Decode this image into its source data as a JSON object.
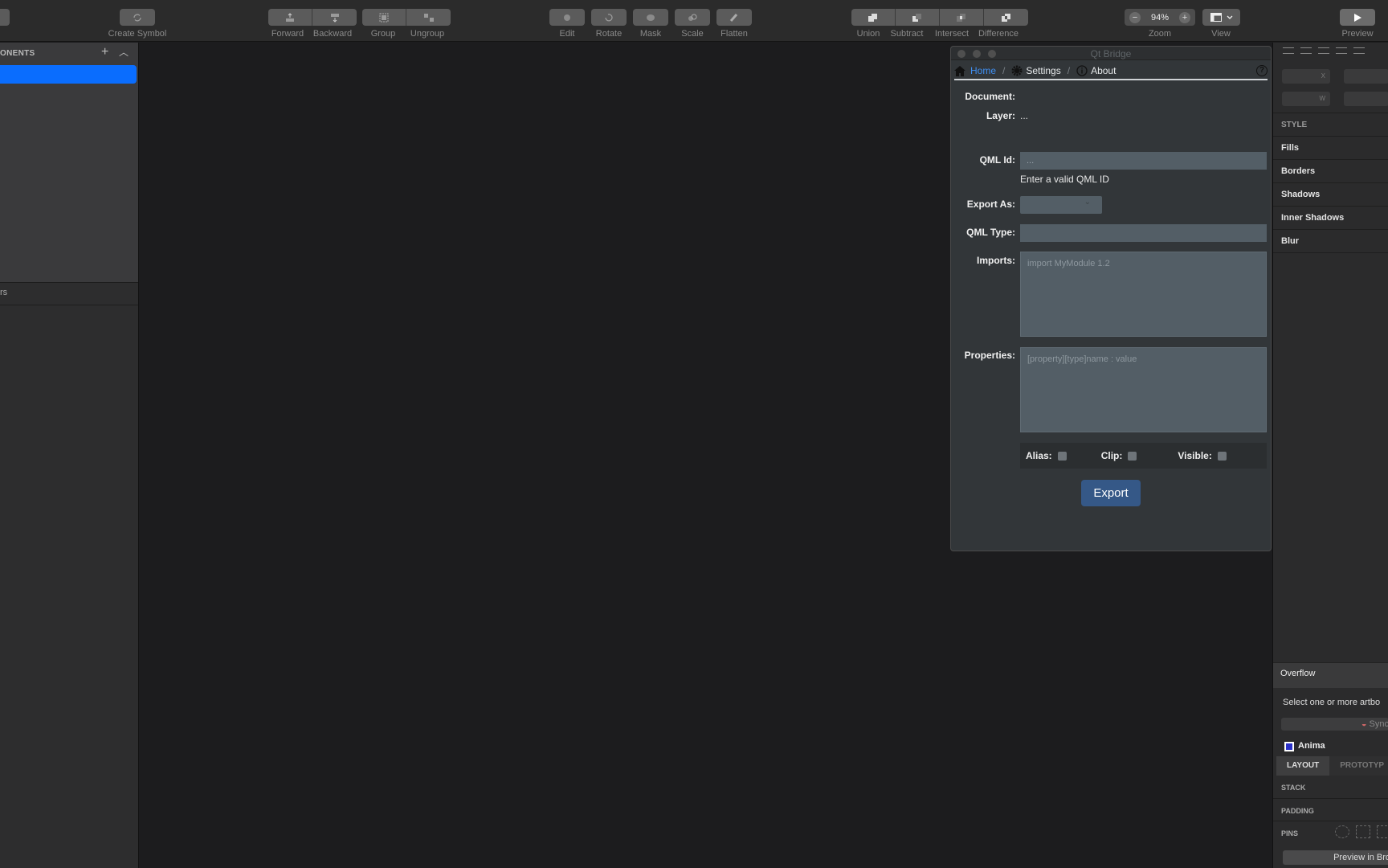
{
  "toolbar": {
    "create_symbol": "Create Symbol",
    "forward": "Forward",
    "backward": "Backward",
    "group": "Group",
    "ungroup": "Ungroup",
    "edit": "Edit",
    "rotate": "Rotate",
    "mask": "Mask",
    "scale": "Scale",
    "flatten": "Flatten",
    "union": "Union",
    "subtract": "Subtract",
    "intersect": "Intersect",
    "difference": "Difference",
    "zoom_value": "94%",
    "zoom_minus": "−",
    "zoom_plus": "+",
    "zoom": "Zoom",
    "view": "View",
    "preview": "Preview"
  },
  "left_panel": {
    "section_title": "ONENTS",
    "lower_text": "rs"
  },
  "qt_bridge": {
    "window_title": "Qt Bridge",
    "nav": {
      "home": "Home",
      "settings": "Settings",
      "about": "About",
      "sep": "/",
      "help": "?"
    },
    "document_label": "Document:",
    "layer_label": "Layer:",
    "layer_value": "...",
    "qml_id_label": "QML Id:",
    "qml_id_value": "...",
    "qml_id_hint": "Enter a valid QML ID",
    "export_as_label": "Export As:",
    "qml_type_label": "QML Type:",
    "imports_label": "Imports:",
    "imports_placeholder": "import MyModule 1.2",
    "properties_label": "Properties:",
    "properties_placeholder": "[property][type]name : value",
    "alias_label": "Alias:",
    "clip_label": "Clip:",
    "visible_label": "Visible:",
    "export_button": "Export"
  },
  "right_panel": {
    "field_x": "X",
    "field_w": "W",
    "style": "STYLE",
    "fills": "Fills",
    "borders": "Borders",
    "shadows": "Shadows",
    "inner_shadows": "Inner Shadows",
    "blur": "Blur",
    "overflow": "Overflow",
    "select_text": "Select one or more artbo",
    "sync": "Sync",
    "anima": "Anima",
    "tab_layout": "LAYOUT",
    "tab_prototype": "PROTOTYP",
    "stack": "STACK",
    "padding": "PADDING",
    "pins": "PINS",
    "preview_in_browser": "Preview in Bro"
  }
}
